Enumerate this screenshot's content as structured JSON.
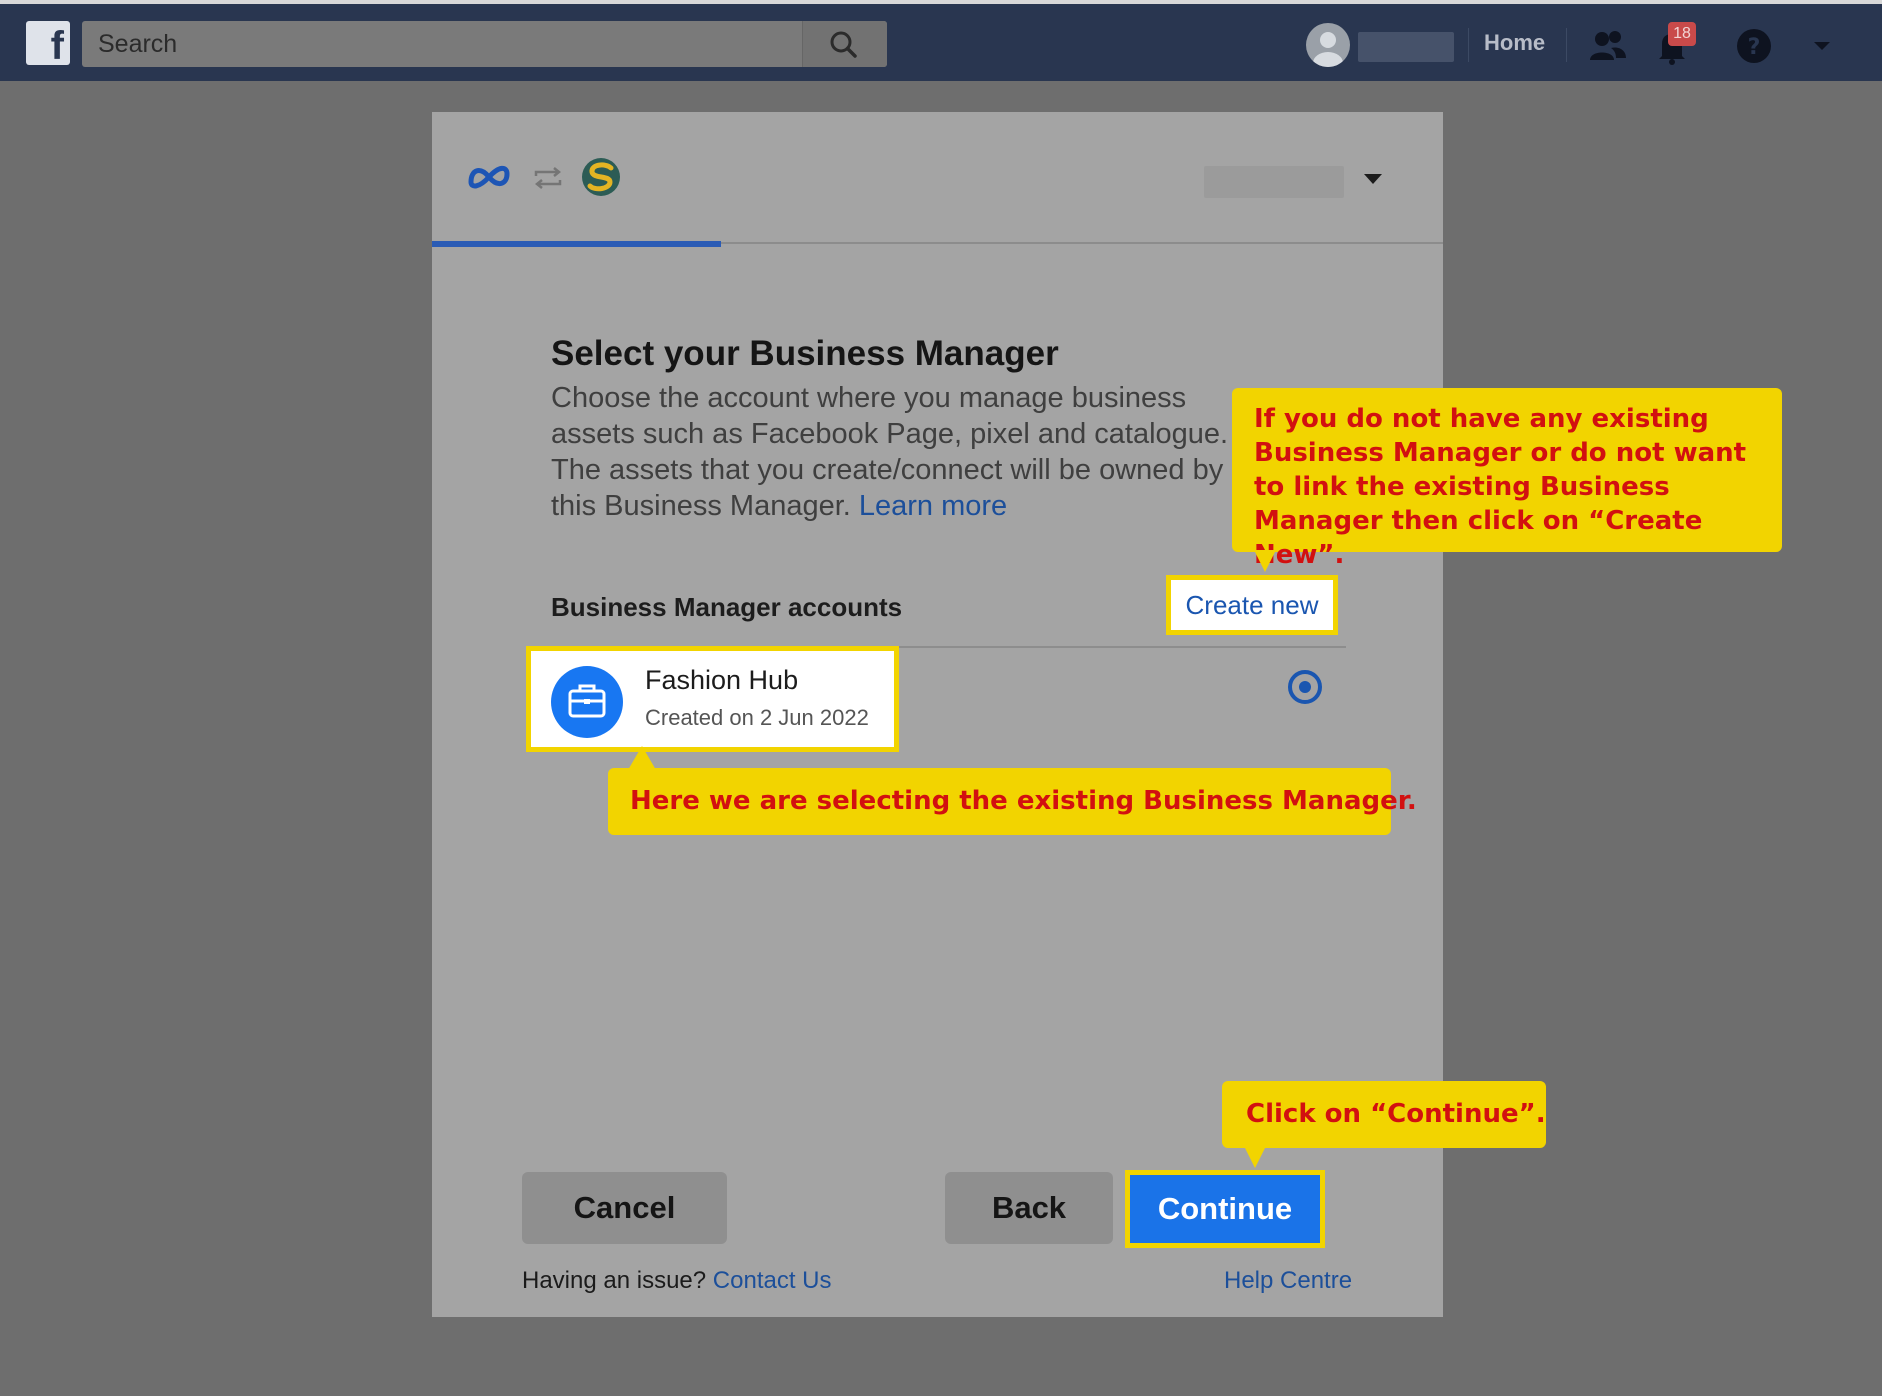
{
  "topbar": {
    "search_placeholder": "Search",
    "home_label": "Home",
    "notifications_count": "18"
  },
  "dialog": {
    "title": "Select your Business Manager",
    "description": "Choose the account where you manage business assets such as Facebook Page, pixel and catalogue. The assets that you create/connect will be owned by this Business Manager.",
    "learn_more": "Learn more",
    "section_label": "Business Manager accounts",
    "create_new": "Create new",
    "account": {
      "name": "Fashion Hub",
      "created": "Created on 2 Jun 2022",
      "selected": true
    },
    "buttons": {
      "cancel": "Cancel",
      "back": "Back",
      "continue": "Continue"
    },
    "footer": {
      "issue_text": "Having an issue?",
      "contact_us": "Contact Us",
      "help_centre": "Help Centre"
    }
  },
  "callouts": {
    "create_new_hint": "If you do not have any existing Business Manager or do not want to link the existing Business Manager then click on “Create New”.",
    "select_hint": "Here we are selecting the existing Business Manager.",
    "continue_hint": "Click on “Continue”."
  },
  "colors": {
    "topbar": "#293650",
    "accent_blue": "#1a73e8",
    "highlight_yellow": "#f2d400",
    "callout_text": "#d21010"
  }
}
